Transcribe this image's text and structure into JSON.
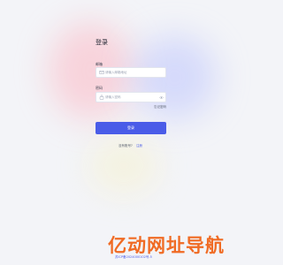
{
  "login": {
    "title": "登录",
    "email_label": "邮箱",
    "email_placeholder": "请输入邮箱地址",
    "password_label": "密码",
    "password_placeholder": "请输入密码",
    "forgot_password": "忘记密码",
    "submit_label": "登录",
    "no_account_text": "没有账号?",
    "register_link": "注册"
  },
  "footer": {
    "logo_text": "亿动网址导航",
    "icp_text": "苏ICP备2024000102号-5"
  },
  "icons": {
    "email": "mail-icon",
    "password": "lock-icon",
    "toggle_password": "eye-icon"
  },
  "colors": {
    "primary": "#4a5ce8",
    "logo": "#f06b24",
    "background": "#f3f4f8"
  }
}
